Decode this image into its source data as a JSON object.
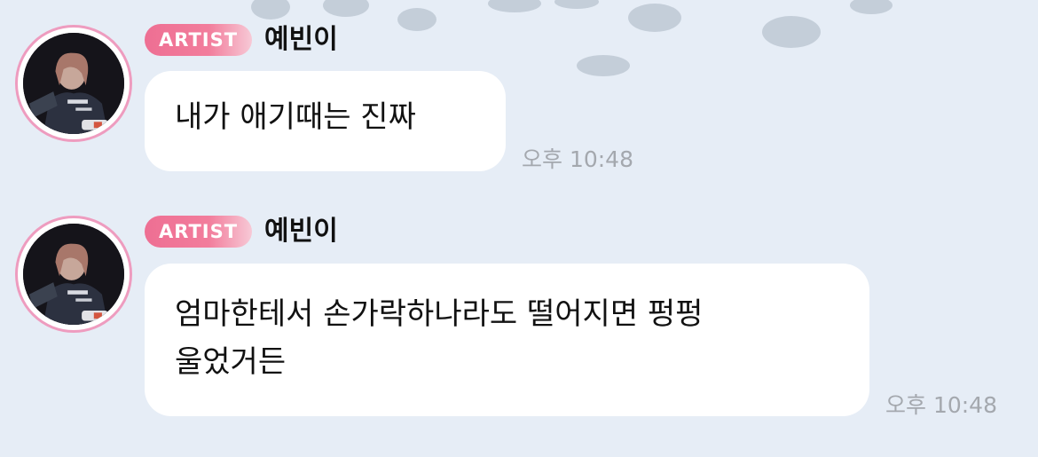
{
  "messages": [
    {
      "badge": "ARTIST",
      "name": "예빈이",
      "lines": [
        "내가 애기때는 진짜"
      ],
      "time": "오후 10:48"
    },
    {
      "badge": "ARTIST",
      "name": "예빈이",
      "lines": [
        "엄마한테서 손가락하나라도 떨어지면 펑펑",
        "울었거든"
      ],
      "time": "오후 10:48"
    }
  ],
  "colors": {
    "background": "#e6edf6",
    "badge_pink": "#ee6f93",
    "avatar_ring": "#ee9cbf",
    "bubble": "#ffffff",
    "timestamp": "#a4a8ae"
  }
}
